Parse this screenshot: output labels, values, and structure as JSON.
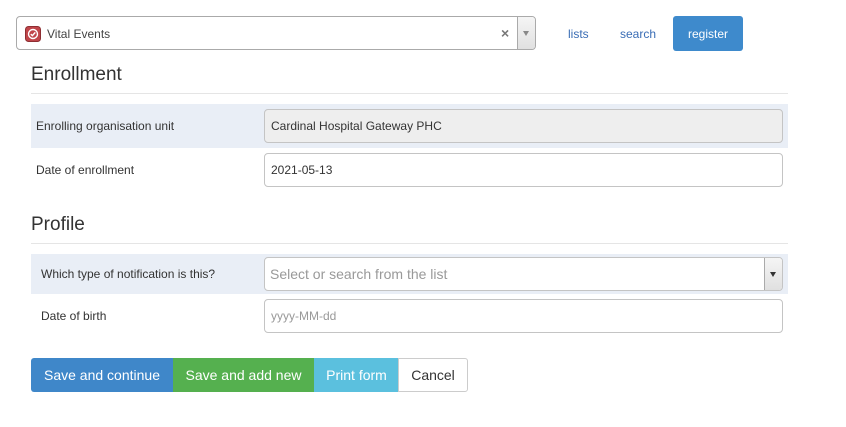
{
  "header": {
    "program": {
      "selected_value": "Vital Events",
      "clear_symbol": "×",
      "icon": "vital-events-icon",
      "icon_color": "#c0454a"
    },
    "nav": {
      "lists_label": "lists",
      "search_label": "search",
      "register_label": "register"
    }
  },
  "enrollment": {
    "title": "Enrollment",
    "rows": [
      {
        "label": "Enrolling organisation unit",
        "value": "Cardinal Hospital Gateway PHC",
        "readonly": true
      },
      {
        "label": "Date of enrollment",
        "value": "2021-05-13",
        "readonly": false
      }
    ]
  },
  "profile": {
    "title": "Profile",
    "rows": [
      {
        "label": "Which type of notification is this?",
        "placeholder": "Select or search from the list",
        "type": "select"
      },
      {
        "label": "Date of birth",
        "placeholder": "yyyy-MM-dd",
        "type": "date"
      }
    ]
  },
  "actions": {
    "save_continue": "Save and continue",
    "save_add_new": "Save and add new",
    "print_form": "Print form",
    "cancel": "Cancel"
  },
  "colors": {
    "primary": "#3f87c9",
    "success": "#55b04f",
    "info": "#5bc0de",
    "row_highlight": "#e9eef6"
  }
}
